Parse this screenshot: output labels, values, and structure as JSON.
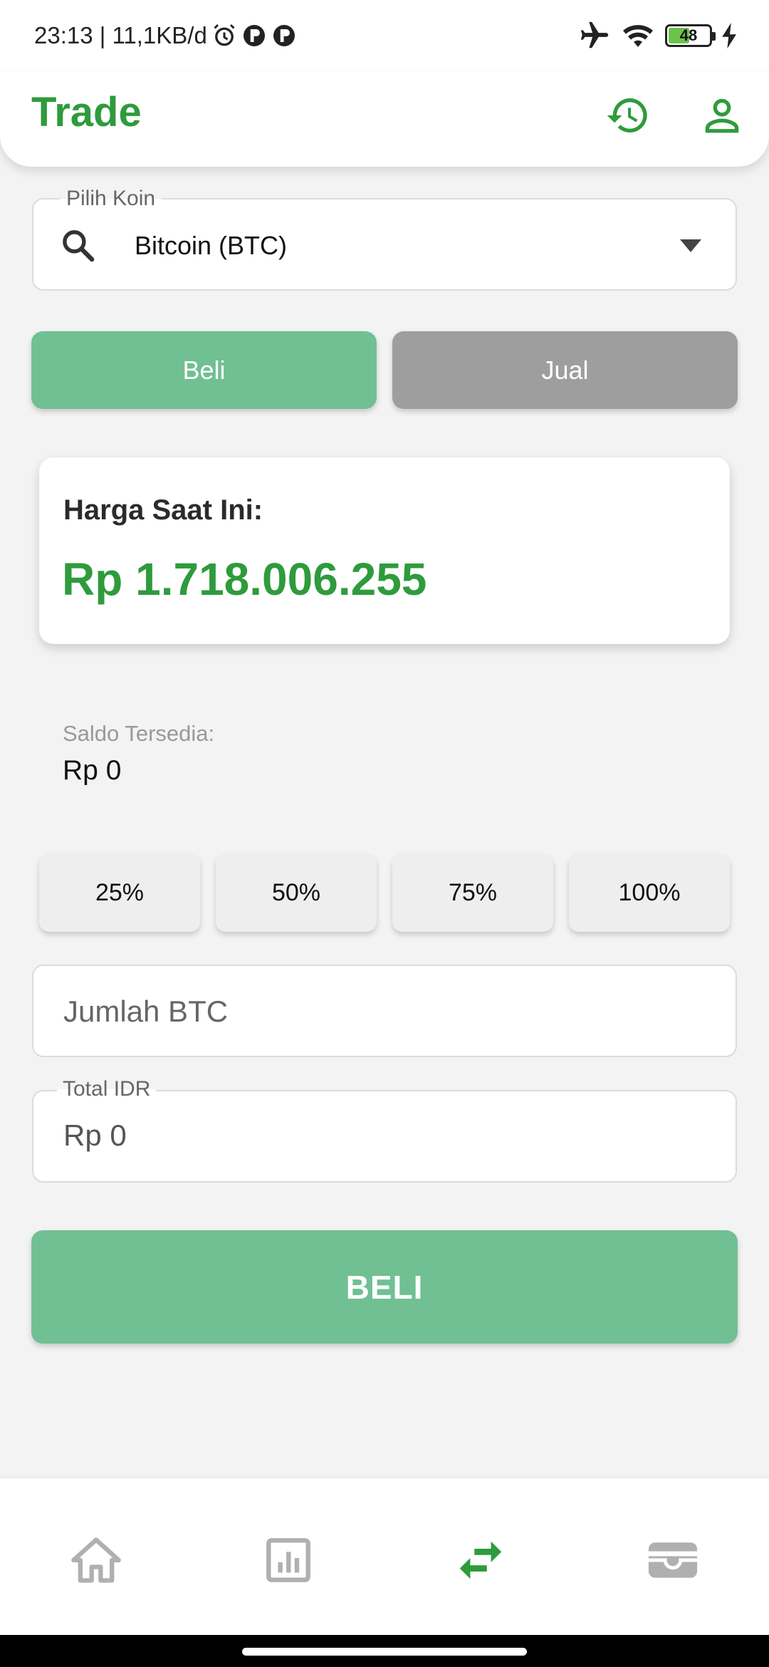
{
  "status_bar": {
    "time_speed": "23:13 | 11,1KB/d",
    "battery_level": "48",
    "icons": [
      "alarm-icon",
      "p-badge-icon",
      "p-badge-icon",
      "airplane-icon",
      "wifi-icon",
      "battery-icon",
      "charging-icon"
    ]
  },
  "header": {
    "title": "Trade",
    "icons": [
      "history-icon",
      "profile-icon"
    ],
    "accent_color": "#2e9b3c"
  },
  "coin_selector": {
    "label": "Pilih Koin",
    "value": "Bitcoin (BTC)"
  },
  "tabs": {
    "buy_label": "Beli",
    "sell_label": "Jual",
    "active": "buy"
  },
  "price_card": {
    "label": "Harga Saat Ini:",
    "value": "Rp 1.718.006.255"
  },
  "balance": {
    "label": "Saldo Tersedia:",
    "value": "Rp 0"
  },
  "percent_buttons": [
    "25%",
    "50%",
    "75%",
    "100%"
  ],
  "amount_input": {
    "placeholder": "Jumlah BTC",
    "value": ""
  },
  "total_input": {
    "label": "Total IDR",
    "value": "Rp 0"
  },
  "action_button": {
    "label": "BELI",
    "color": "#70c093"
  },
  "bottom_nav": {
    "items": [
      "home-icon",
      "chart-icon",
      "swap-icon",
      "wallet-icon"
    ],
    "active": "swap-icon",
    "inactive_color": "#b0b0b0"
  }
}
